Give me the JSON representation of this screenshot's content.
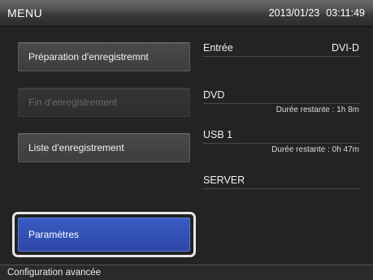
{
  "header": {
    "title": "MENU",
    "date": "2013/01/23",
    "time": "03:11:49"
  },
  "menu": {
    "preparation_label": "Préparation d'enregistremnt",
    "fin_label": "Fin d'enregistrement",
    "liste_label": "Liste d'enregistrement",
    "parametres_label": "Paramètres",
    "selected_item": "Paramètres"
  },
  "info": {
    "entree": {
      "label": "Entrée",
      "value": "DVI-D"
    },
    "dvd": {
      "label": "DVD",
      "remaining": "Durée restante : 1h 8m"
    },
    "usb": {
      "label": "USB 1",
      "remaining": "Durée restante : 0h 47m"
    },
    "server": {
      "label": "SERVER"
    }
  },
  "status": {
    "text": "Configuration avancée"
  },
  "colors": {
    "selected_button": "#2c47a8",
    "background": "#232323",
    "disabled_text": "#6a6a6a"
  }
}
